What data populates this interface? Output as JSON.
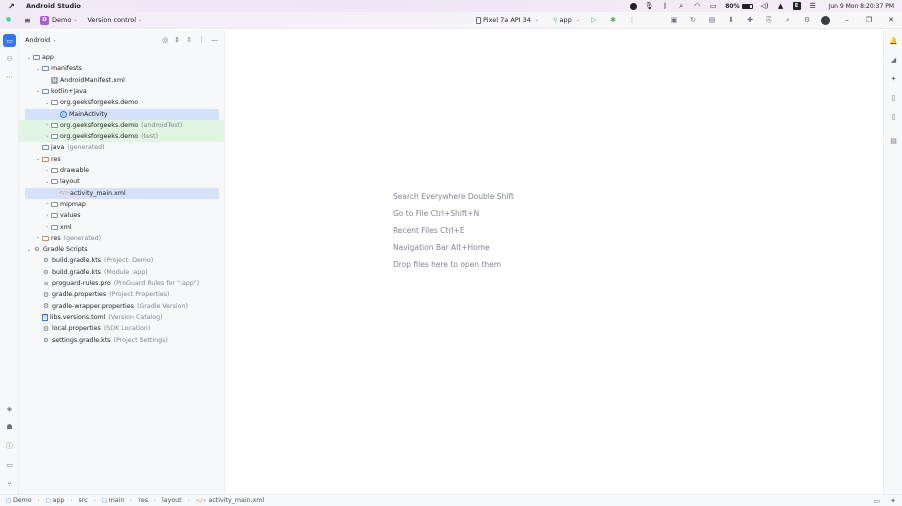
{
  "macbar": {
    "app_name": "Android Studio",
    "battery": "80%",
    "clock": "Jun 9 Mon 8:20:37 PM",
    "badge_letter": "E"
  },
  "toolbar": {
    "project_badge": "D",
    "project_name": "Demo",
    "vcs_label": "Version control",
    "device": "Pixel 7a API 34",
    "run_config": "app"
  },
  "panel": {
    "title": "Android"
  },
  "tree": [
    {
      "label": "app",
      "hint": "",
      "depth": 0,
      "arrow": "v",
      "icon": "folder",
      "state": ""
    },
    {
      "label": "manifests",
      "hint": "",
      "depth": 1,
      "arrow": "v",
      "icon": "folder",
      "state": ""
    },
    {
      "label": "AndroidManifest.xml",
      "hint": "",
      "depth": 2,
      "arrow": "",
      "icon": "manifest",
      "state": ""
    },
    {
      "label": "kotlin+java",
      "hint": "",
      "depth": 1,
      "arrow": "v",
      "icon": "folder",
      "state": ""
    },
    {
      "label": "org.geeksforgeeks.demo",
      "hint": "",
      "depth": 2,
      "arrow": "v",
      "icon": "folder-pkg",
      "state": ""
    },
    {
      "label": "MainActivity",
      "hint": "",
      "depth": 3,
      "arrow": "",
      "icon": "class",
      "state": "sel"
    },
    {
      "label": "org.geeksforgeeks.demo",
      "hint": "(androidTest)",
      "depth": 2,
      "arrow": ">",
      "icon": "folder-pkg",
      "state": "test"
    },
    {
      "label": "org.geeksforgeeks.demo",
      "hint": "(test)",
      "depth": 2,
      "arrow": ">",
      "icon": "folder-pkg",
      "state": "test"
    },
    {
      "label": "java",
      "hint": "(generated)",
      "depth": 1,
      "arrow": "",
      "icon": "folder",
      "state": ""
    },
    {
      "label": "res",
      "hint": "",
      "depth": 1,
      "arrow": "v",
      "icon": "folder-res",
      "state": ""
    },
    {
      "label": "drawable",
      "hint": "",
      "depth": 2,
      "arrow": ">",
      "icon": "folder-pkg",
      "state": ""
    },
    {
      "label": "layout",
      "hint": "",
      "depth": 2,
      "arrow": "v",
      "icon": "folder-pkg",
      "state": ""
    },
    {
      "label": "activity_main.xml",
      "hint": "",
      "depth": 3,
      "arrow": "",
      "icon": "xml",
      "state": "sel"
    },
    {
      "label": "mipmap",
      "hint": "",
      "depth": 2,
      "arrow": ">",
      "icon": "folder-pkg",
      "state": ""
    },
    {
      "label": "values",
      "hint": "",
      "depth": 2,
      "arrow": ">",
      "icon": "folder-pkg",
      "state": ""
    },
    {
      "label": "xml",
      "hint": "",
      "depth": 2,
      "arrow": ">",
      "icon": "folder-pkg",
      "state": ""
    },
    {
      "label": "res",
      "hint": "(generated)",
      "depth": 1,
      "arrow": ">",
      "icon": "folder-res",
      "state": ""
    },
    {
      "label": "Gradle Scripts",
      "hint": "",
      "depth": 0,
      "arrow": "v",
      "icon": "gradle",
      "state": ""
    },
    {
      "label": "build.gradle.kts",
      "hint": "(Project: Demo)",
      "depth": 1,
      "arrow": "",
      "icon": "gradle",
      "state": ""
    },
    {
      "label": "build.gradle.kts",
      "hint": "(Module :app)",
      "depth": 1,
      "arrow": "",
      "icon": "gradle",
      "state": ""
    },
    {
      "label": "proguard-rules.pro",
      "hint": "(ProGuard Rules for \":app\")",
      "depth": 1,
      "arrow": "",
      "icon": "lines",
      "state": ""
    },
    {
      "label": "gradle.properties",
      "hint": "(Project Properties)",
      "depth": 1,
      "arrow": "",
      "icon": "gear",
      "state": ""
    },
    {
      "label": "gradle-wrapper.properties",
      "hint": "(Gradle Version)",
      "depth": 1,
      "arrow": "",
      "icon": "gear",
      "state": ""
    },
    {
      "label": "libs.versions.toml",
      "hint": "(Version Catalog)",
      "depth": 1,
      "arrow": "",
      "icon": "toml",
      "state": ""
    },
    {
      "label": "local.properties",
      "hint": "(SDK Location)",
      "depth": 1,
      "arrow": "",
      "icon": "gear",
      "state": ""
    },
    {
      "label": "settings.gradle.kts",
      "hint": "(Project Settings)",
      "depth": 1,
      "arrow": "",
      "icon": "gradle",
      "state": ""
    }
  ],
  "editor": {
    "hints": [
      "Search Everywhere Double Shift",
      "Go to File Ctrl+Shift+N",
      "Recent Files Ctrl+E",
      "Navigation Bar Alt+Home",
      "Drop files here to open them"
    ]
  },
  "breadcrumb": [
    "Demo",
    "app",
    "src",
    "main",
    "res",
    "layout",
    "activity_main.xml"
  ]
}
